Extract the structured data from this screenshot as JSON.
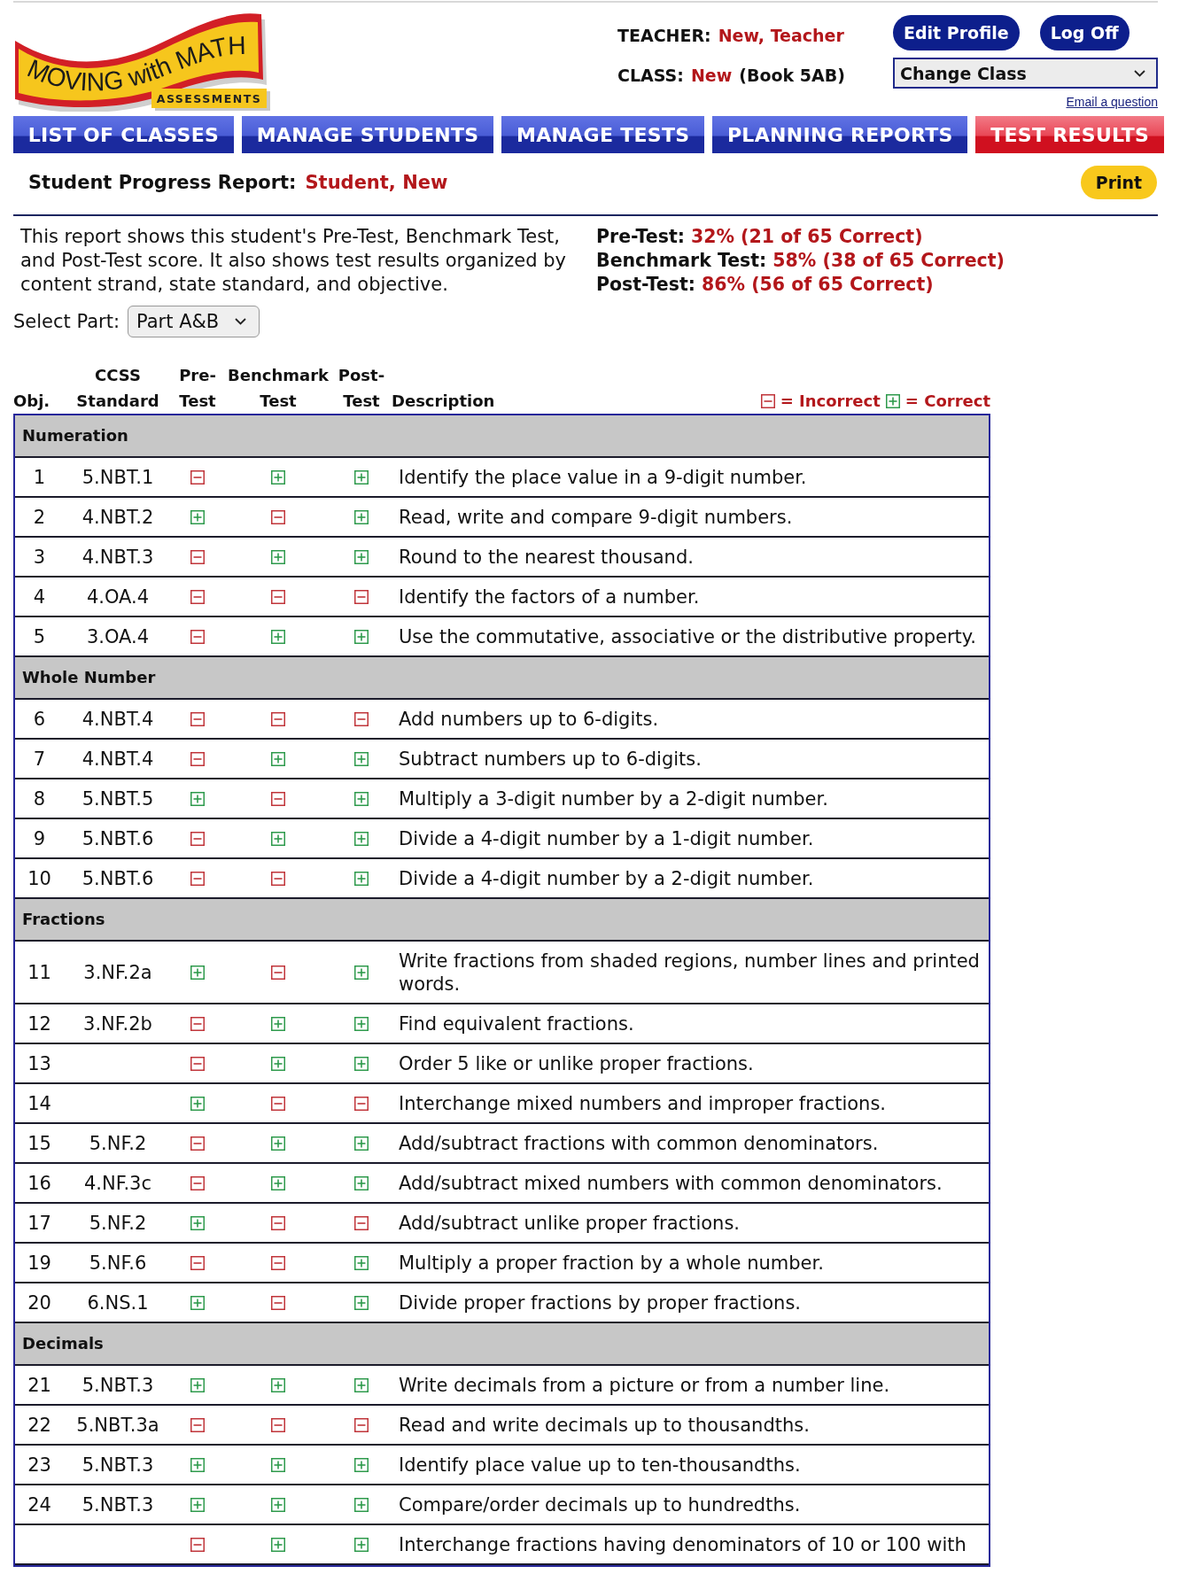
{
  "logo": {
    "title": "MOVING with MATH",
    "subtitle": "ASSESSMENTS"
  },
  "account": {
    "teacher_label": "TEACHER:",
    "teacher_name": "New, Teacher",
    "class_label": "CLASS:",
    "class_name": "New",
    "class_book": "(Book 5AB)",
    "buttons": [
      "Edit Profile",
      "Log Off"
    ],
    "class_select": {
      "value": "Change Class"
    },
    "email_link": "Email a question"
  },
  "nav": {
    "tabs": [
      {
        "label": "LIST OF CLASSES",
        "selected": false
      },
      {
        "label": "MANAGE STUDENTS",
        "selected": false
      },
      {
        "label": "MANAGE TESTS",
        "selected": false
      },
      {
        "label": "PLANNING REPORTS",
        "selected": false
      },
      {
        "label": "TEST RESULTS",
        "selected": true
      }
    ]
  },
  "report": {
    "title": "Student Progress Report:",
    "student": "Student, New",
    "print_button": "Print",
    "intro": "This report shows this student's Pre-Test, Benchmark Test, and Post-Test score. It also shows test results organized by content strand, state standard, and objective.",
    "scores": [
      {
        "label": "Pre-Test:",
        "value": "32% (21 of 65 Correct)"
      },
      {
        "label": "Benchmark Test:",
        "value": "58% (38 of 65 Correct)"
      },
      {
        "label": "Post-Test:",
        "value": "86% (56 of 65 Correct)"
      }
    ],
    "select_part": {
      "label": "Select Part:",
      "value": "Part A&B"
    }
  },
  "table": {
    "columns": [
      "Obj.",
      "CCSS Standard",
      "Pre- Test",
      "Benchmark Test",
      "Post- Test",
      "Description"
    ],
    "legend": [
      {
        "correct": false,
        "label": "= Incorrect"
      },
      {
        "correct": true,
        "label": "= Correct"
      }
    ],
    "sections": [
      {
        "title": "Numeration",
        "rows": [
          {
            "obj": "1",
            "standard": "5.NBT.1",
            "pre_correct": false,
            "benchmark_correct": true,
            "post_correct": true,
            "description": "Identify the place value in a 9-digit number."
          },
          {
            "obj": "2",
            "standard": "4.NBT.2",
            "pre_correct": true,
            "benchmark_correct": false,
            "post_correct": true,
            "description": "Read, write and compare 9-digit numbers."
          },
          {
            "obj": "3",
            "standard": "4.NBT.3",
            "pre_correct": false,
            "benchmark_correct": true,
            "post_correct": true,
            "description": "Round to the nearest thousand."
          },
          {
            "obj": "4",
            "standard": "4.OA.4",
            "pre_correct": false,
            "benchmark_correct": false,
            "post_correct": false,
            "description": "Identify the factors of a number."
          },
          {
            "obj": "5",
            "standard": "3.OA.4",
            "pre_correct": false,
            "benchmark_correct": true,
            "post_correct": true,
            "description": "Use the commutative, associative or the distributive property."
          }
        ]
      },
      {
        "title": "Whole Number",
        "rows": [
          {
            "obj": "6",
            "standard": "4.NBT.4",
            "pre_correct": false,
            "benchmark_correct": false,
            "post_correct": false,
            "description": "Add numbers up to 6-digits."
          },
          {
            "obj": "7",
            "standard": "4.NBT.4",
            "pre_correct": false,
            "benchmark_correct": true,
            "post_correct": true,
            "description": "Subtract numbers up to 6-digits."
          },
          {
            "obj": "8",
            "standard": "5.NBT.5",
            "pre_correct": true,
            "benchmark_correct": false,
            "post_correct": true,
            "description": "Multiply a 3-digit number by a 2-digit number."
          },
          {
            "obj": "9",
            "standard": "5.NBT.6",
            "pre_correct": false,
            "benchmark_correct": true,
            "post_correct": true,
            "description": "Divide a 4-digit number by a 1-digit number."
          },
          {
            "obj": "10",
            "standard": "5.NBT.6",
            "pre_correct": false,
            "benchmark_correct": false,
            "post_correct": true,
            "description": "Divide a 4-digit number by a 2-digit number."
          }
        ]
      },
      {
        "title": "Fractions",
        "rows": [
          {
            "obj": "11",
            "standard": "3.NF.2a",
            "pre_correct": true,
            "benchmark_correct": false,
            "post_correct": true,
            "description": "Write fractions from shaded regions, number lines and printed words."
          },
          {
            "obj": "12",
            "standard": "3.NF.2b",
            "pre_correct": false,
            "benchmark_correct": true,
            "post_correct": true,
            "description": "Find equivalent fractions."
          },
          {
            "obj": "13",
            "pre_correct": false,
            "benchmark_correct": true,
            "post_correct": true,
            "description": "Order 5 like or unlike proper fractions."
          },
          {
            "obj": "14",
            "pre_correct": true,
            "benchmark_correct": false,
            "post_correct": false,
            "description": "Interchange mixed numbers and improper fractions."
          },
          {
            "obj": "15",
            "standard": "5.NF.2",
            "pre_correct": false,
            "benchmark_correct": true,
            "post_correct": true,
            "description": "Add/subtract fractions with common denominators."
          },
          {
            "obj": "16",
            "standard": "4.NF.3c",
            "pre_correct": false,
            "benchmark_correct": true,
            "post_correct": true,
            "description": "Add/subtract mixed numbers with common denominators."
          },
          {
            "obj": "17",
            "standard": "5.NF.2",
            "pre_correct": true,
            "benchmark_correct": false,
            "post_correct": false,
            "description": "Add/subtract unlike proper fractions."
          },
          {
            "obj": "19",
            "standard": "5.NF.6",
            "pre_correct": false,
            "benchmark_correct": false,
            "post_correct": true,
            "description": "Multiply a proper fraction by a whole number."
          },
          {
            "obj": "20",
            "standard": "6.NS.1",
            "pre_correct": true,
            "benchmark_correct": false,
            "post_correct": true,
            "description": "Divide proper fractions by proper fractions."
          }
        ]
      },
      {
        "title": "Decimals",
        "rows": [
          {
            "obj": "21",
            "standard": "5.NBT.3",
            "pre_correct": true,
            "benchmark_correct": true,
            "post_correct": true,
            "description": "Write decimals from a picture or from a number line."
          },
          {
            "obj": "22",
            "standard": "5.NBT.3a",
            "pre_correct": false,
            "benchmark_correct": false,
            "post_correct": false,
            "description": "Read and write decimals up to thousandths."
          },
          {
            "obj": "23",
            "standard": "5.NBT.3",
            "pre_correct": true,
            "benchmark_correct": true,
            "post_correct": true,
            "description": "Identify place value up to ten-thousandths."
          },
          {
            "obj": "24",
            "standard": "5.NBT.3",
            "pre_correct": true,
            "benchmark_correct": true,
            "post_correct": true,
            "description": "Compare/order decimals up to hundredths."
          },
          {
            "pre_correct": false,
            "benchmark_correct": true,
            "post_correct": true,
            "description": "Interchange fractions having denominators of 10 or 100 with"
          }
        ]
      }
    ]
  }
}
